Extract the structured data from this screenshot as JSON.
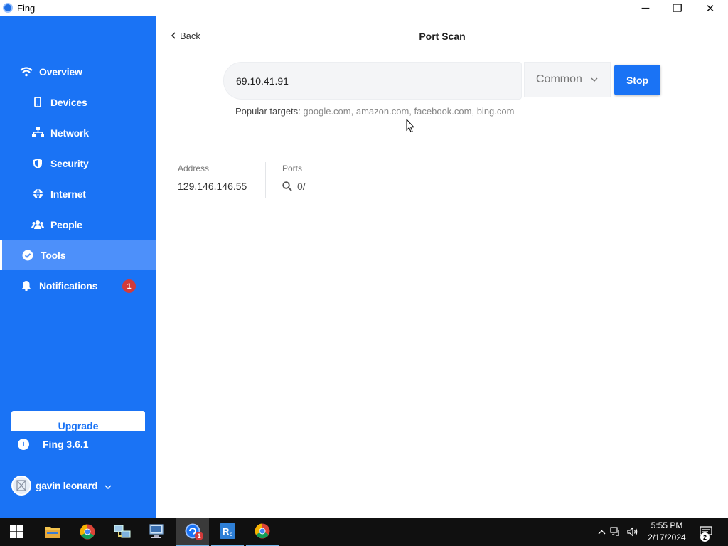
{
  "window": {
    "title": "Fing",
    "minimize_glyph": "─",
    "maximize_glyph": "❐",
    "close_glyph": "✕"
  },
  "sidebar": {
    "items": [
      {
        "label": "Overview",
        "icon": "wifi-icon"
      },
      {
        "label": "Devices",
        "icon": "phone-icon"
      },
      {
        "label": "Network",
        "icon": "network-icon"
      },
      {
        "label": "Security",
        "icon": "shield-icon"
      },
      {
        "label": "Internet",
        "icon": "globe-icon"
      },
      {
        "label": "People",
        "icon": "people-icon"
      },
      {
        "label": "Tools",
        "icon": "check-circle-icon",
        "active": true
      },
      {
        "label": "Notifications",
        "icon": "bell-icon",
        "badge": "1"
      }
    ],
    "upgrade_label": "Upgrade",
    "version": "Fing 3.6.1",
    "user_name": "gavin leonard"
  },
  "main": {
    "back_label": "Back",
    "title": "Port Scan",
    "target_value": "69.10.41.91",
    "scan_mode": "Common",
    "stop_label": "Stop",
    "popular_prefix": "Popular targets:",
    "popular_targets": [
      "google.com,",
      "amazon.com,",
      "facebook.com,",
      "bing.com"
    ],
    "address_label": "Address",
    "address_value": "129.146.146.55",
    "ports_label": "Ports",
    "ports_value": "0/"
  },
  "taskbar": {
    "apps": [
      {
        "name": "start-button",
        "icon": "windows-icon"
      },
      {
        "name": "file-explorer",
        "icon": "folder-icon"
      },
      {
        "name": "chrome",
        "icon": "chrome-icon"
      },
      {
        "name": "network-tool",
        "icon": "network-tool-icon"
      },
      {
        "name": "remote-desktop",
        "icon": "computer-icon"
      },
      {
        "name": "fing",
        "icon": "fing-icon",
        "badge": "1",
        "active": true
      },
      {
        "name": "remote-app",
        "icon": "rc-icon",
        "open": true
      },
      {
        "name": "chrome-2",
        "icon": "chrome-icon",
        "open": true
      }
    ],
    "time": "5:55 PM",
    "date": "2/17/2024",
    "notification_count": "2"
  },
  "colors": {
    "accent": "#1a73f5",
    "sidebar_active": "#4d90fa",
    "badge": "#d23b3b"
  }
}
